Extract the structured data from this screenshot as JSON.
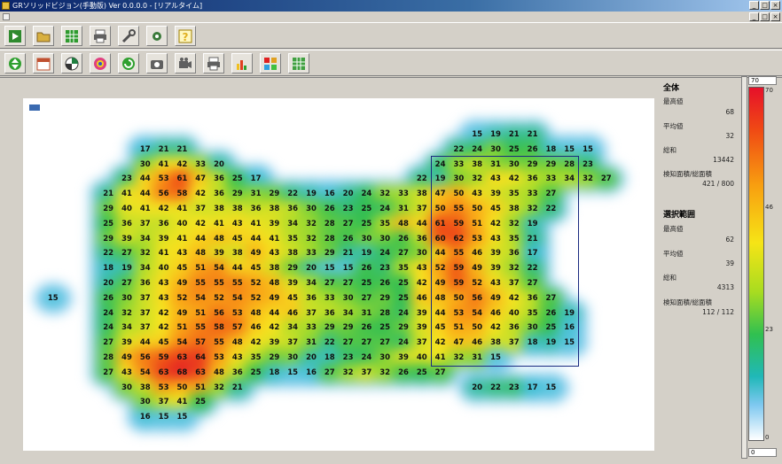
{
  "window": {
    "title": "GRソリッドビジョン(手動版) Ver 0.0.0.0 - [リアルタイム]",
    "minimize": "_",
    "maximize": "□",
    "close": "×"
  },
  "toolbar1": {
    "buttons": [
      {
        "name": "play-icon",
        "color": "#2e8a2e"
      },
      {
        "name": "open-folder-icon",
        "color": "#d8b040"
      },
      {
        "name": "grid-icon",
        "color": "#2e9a2e"
      },
      {
        "name": "printer-icon",
        "color": "#606060"
      },
      {
        "name": "wrench-icon",
        "color": "#505050"
      },
      {
        "name": "settings-icon",
        "color": "#3a7a3a"
      },
      {
        "name": "help-icon",
        "color": "#e0b020"
      }
    ]
  },
  "toolbar2": {
    "buttons": [
      {
        "name": "up-down-icon",
        "color": "#30a030"
      },
      {
        "name": "calendar-icon",
        "color": "#c05030"
      },
      {
        "name": "pie-chart-icon",
        "color": "#208040"
      },
      {
        "name": "color-wheel-icon",
        "color": "#e04080"
      },
      {
        "name": "refresh-icon",
        "color": "#30a030"
      },
      {
        "name": "camera-icon",
        "color": "#606060"
      },
      {
        "name": "video-camera-icon",
        "color": "#606060"
      },
      {
        "name": "printer-icon",
        "color": "#606060"
      },
      {
        "name": "bar-chart-icon",
        "color": "#e04020"
      },
      {
        "name": "heatmap-grid-icon",
        "color": "#e0a020"
      },
      {
        "name": "green-grid-icon",
        "color": "#40a040"
      }
    ]
  },
  "panel": {
    "all": {
      "title": "全体",
      "max_label": "最高値",
      "max_value": "68",
      "avg_label": "平均値",
      "avg_value": "32",
      "total_label": "総和",
      "total_value": "13442",
      "area_label": "検知面積/総面積",
      "area_value": "421 / 800"
    },
    "selection": {
      "title": "選択範囲",
      "max_label": "最高値",
      "max_value": "62",
      "avg_label": "平均値",
      "avg_value": "39",
      "total_label": "総和",
      "total_value": "4313",
      "area_label": "検知面積/総面積",
      "area_value": "112 / 112"
    }
  },
  "legend": {
    "top_field": "70",
    "bottom_field": "0",
    "ticks": [
      {
        "label": "70",
        "value": 70
      },
      {
        "label": "46",
        "value": 46
      },
      {
        "label": "23",
        "value": 23
      },
      {
        "label": "0",
        "value": 0
      }
    ]
  },
  "chart_data": {
    "type": "heatmap",
    "vmin": 0,
    "vmax": 70,
    "selection": {
      "row_start": 2,
      "row_end": 15,
      "col_start": 22,
      "col_end": 29
    },
    "rows": [
      {
        "row": 0,
        "start": 24,
        "values": [
          15,
          19,
          21,
          21
        ]
      },
      {
        "row": 1,
        "start": 6,
        "values": [
          17,
          21,
          21
        ]
      },
      {
        "row": 1,
        "start": 23,
        "values": [
          22,
          24,
          30,
          25,
          26,
          18,
          15,
          15
        ]
      },
      {
        "row": 2,
        "start": 6,
        "values": [
          30,
          41,
          42,
          33,
          20
        ]
      },
      {
        "row": 2,
        "start": 22,
        "values": [
          24,
          33,
          38,
          31,
          30,
          29,
          29,
          28,
          23
        ]
      },
      {
        "row": 3,
        "start": 5,
        "values": [
          23,
          44,
          53,
          61,
          47,
          36,
          25,
          17
        ]
      },
      {
        "row": 3,
        "start": 21,
        "values": [
          22,
          19,
          30,
          32,
          43,
          42,
          36,
          33,
          34,
          32,
          27
        ]
      },
      {
        "row": 4,
        "start": 4,
        "values": [
          21,
          41,
          44,
          56,
          58,
          42,
          36,
          29,
          31,
          29,
          22,
          19,
          16,
          20,
          24,
          32,
          33,
          38,
          47,
          50,
          43,
          39,
          35,
          33,
          27
        ]
      },
      {
        "row": 5,
        "start": 4,
        "values": [
          29,
          40,
          41,
          42,
          41,
          37,
          38,
          38,
          36,
          38,
          36,
          30,
          26,
          23,
          25,
          24,
          31,
          37,
          50,
          55,
          50,
          45,
          38,
          32,
          22
        ]
      },
      {
        "row": 6,
        "start": 4,
        "values": [
          25,
          36,
          37,
          36,
          40,
          42,
          41,
          43,
          41,
          39,
          34,
          32,
          28,
          27,
          25,
          35,
          48,
          44,
          61,
          59,
          51,
          42,
          32,
          19
        ]
      },
      {
        "row": 7,
        "start": 4,
        "values": [
          29,
          39,
          34,
          39,
          41,
          44,
          48,
          45,
          44,
          41,
          35,
          32,
          28,
          26,
          30,
          30,
          26,
          36,
          60,
          62,
          53,
          43,
          35,
          21
        ]
      },
      {
        "row": 8,
        "start": 4,
        "values": [
          22,
          27,
          32,
          41,
          43,
          48,
          39,
          38,
          49,
          43,
          38,
          33,
          29,
          21,
          19,
          24,
          27,
          30,
          44,
          55,
          46,
          39,
          36,
          17
        ]
      },
      {
        "row": 9,
        "start": 4,
        "values": [
          18,
          19,
          34,
          40,
          45,
          51,
          54,
          44,
          45,
          38,
          29,
          20,
          15,
          15,
          26,
          23,
          35,
          43,
          52,
          59,
          49,
          39,
          32,
          22
        ]
      },
      {
        "row": 10,
        "start": 4,
        "values": [
          20,
          27,
          36,
          43,
          49,
          55,
          55,
          55,
          52,
          48,
          39,
          34,
          27,
          27,
          25,
          26,
          25,
          42,
          49,
          59,
          52,
          43,
          37,
          27
        ]
      },
      {
        "row": 11,
        "start": 1,
        "values": [
          15
        ]
      },
      {
        "row": 11,
        "start": 4,
        "values": [
          26,
          30,
          37,
          43,
          52,
          54,
          52,
          54,
          52,
          49,
          45,
          36,
          33,
          30,
          27,
          29,
          25,
          46,
          48,
          50,
          56,
          49,
          42,
          36,
          27
        ]
      },
      {
        "row": 12,
        "start": 4,
        "values": [
          24,
          32,
          37,
          42,
          49,
          51,
          56,
          53,
          48,
          44,
          46,
          37,
          36,
          34,
          31,
          28,
          24,
          39,
          44,
          53,
          54,
          46,
          40,
          35,
          26,
          19
        ]
      },
      {
        "row": 13,
        "start": 4,
        "values": [
          24,
          34,
          37,
          42,
          51,
          55,
          58,
          57,
          46,
          42,
          34,
          33,
          29,
          29,
          26,
          25,
          29,
          39,
          45,
          51,
          50,
          42,
          36,
          30,
          25,
          16
        ]
      },
      {
        "row": 14,
        "start": 4,
        "values": [
          27,
          39,
          44,
          45,
          54,
          57,
          55,
          48,
          42,
          39,
          37,
          31,
          22,
          27,
          27,
          27,
          24,
          37,
          42,
          47,
          46,
          38,
          37,
          18,
          19,
          15
        ]
      },
      {
        "row": 15,
        "start": 4,
        "values": [
          28,
          49,
          56,
          59,
          63,
          64,
          53,
          43,
          35,
          29,
          30,
          20,
          18,
          23,
          24,
          30,
          39,
          40,
          41,
          32,
          31,
          15
        ]
      },
      {
        "row": 16,
        "start": 4,
        "values": [
          27,
          43,
          54,
          63,
          68,
          63,
          48,
          36,
          25,
          18,
          15,
          16,
          27,
          32,
          37,
          32,
          26,
          25,
          27
        ]
      },
      {
        "row": 17,
        "start": 5,
        "values": [
          30,
          38,
          53,
          50,
          51,
          32,
          21
        ]
      },
      {
        "row": 17,
        "start": 24,
        "values": [
          20,
          22,
          23,
          17,
          15
        ]
      },
      {
        "row": 18,
        "start": 6,
        "values": [
          30,
          37,
          41,
          25
        ]
      },
      {
        "row": 19,
        "start": 6,
        "values": [
          16,
          15,
          15
        ]
      }
    ]
  }
}
